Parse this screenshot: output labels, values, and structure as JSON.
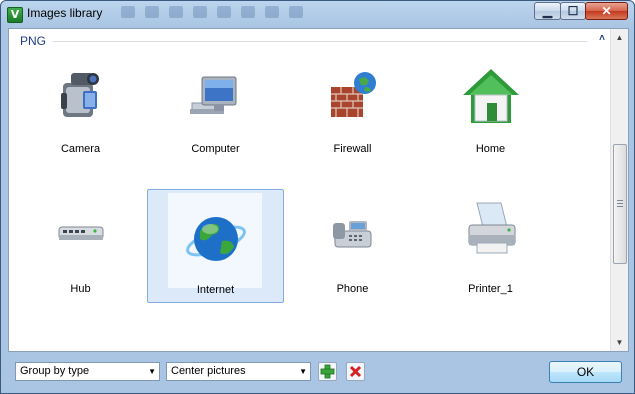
{
  "window": {
    "title": "Images library",
    "app_icon_letter": "V"
  },
  "window_controls": {
    "minimize": "▁",
    "maximize": "☐",
    "close": "✕"
  },
  "group": {
    "title": "PNG",
    "collapse_glyph": "˄"
  },
  "items": [
    {
      "label": "Camera",
      "icon": "camera-icon",
      "selected": false
    },
    {
      "label": "Computer",
      "icon": "computer-icon",
      "selected": false
    },
    {
      "label": "Firewall",
      "icon": "firewall-icon",
      "selected": false
    },
    {
      "label": "Home",
      "icon": "home-icon",
      "selected": false
    },
    {
      "label": "Hub",
      "icon": "hub-icon",
      "selected": false
    },
    {
      "label": "Internet",
      "icon": "internet-icon",
      "selected": true
    },
    {
      "label": "Phone",
      "icon": "phone-icon",
      "selected": false
    },
    {
      "label": "Printer_1",
      "icon": "printer-icon",
      "selected": false
    }
  ],
  "footer": {
    "group_select": "Group by type",
    "align_select": "Center pictures",
    "add_icon": "add-icon",
    "delete_icon": "delete-icon",
    "ok_label": "OK"
  },
  "colors": {
    "selection_bg": "#dce9f8",
    "group_title": "#1e3c8c"
  }
}
